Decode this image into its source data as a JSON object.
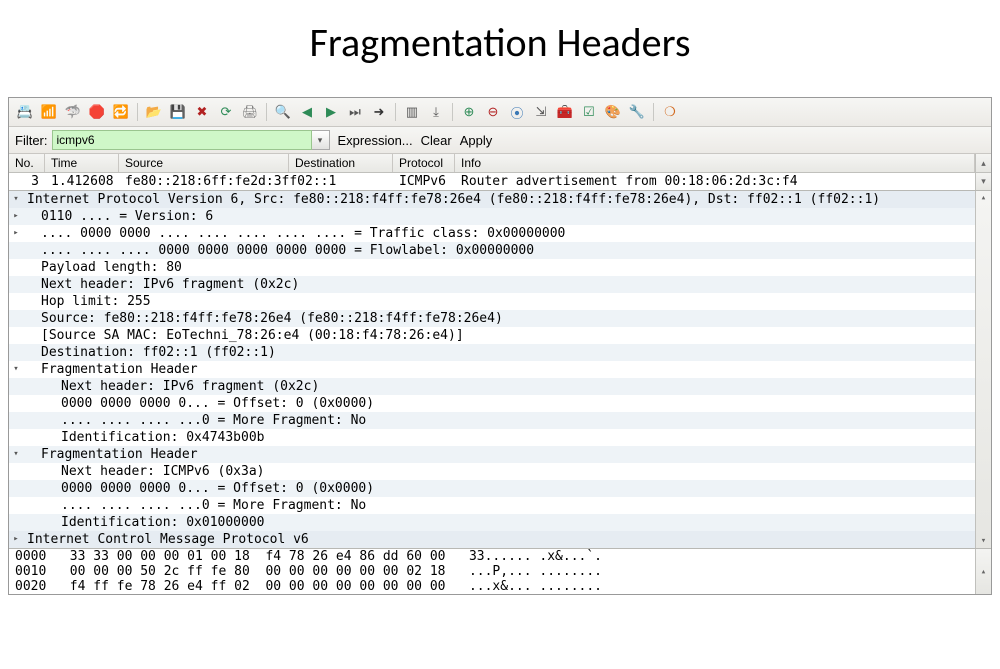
{
  "title": "Fragmentation Headers",
  "toolbar_icons": [
    {
      "name": "adapter-list-icon",
      "glyph": "📇",
      "color": "#777"
    },
    {
      "name": "adapter-options-icon",
      "glyph": "📶",
      "color": "#8a6d3b"
    },
    {
      "name": "start-capture-icon",
      "glyph": "🦈",
      "color": "#6b8e23"
    },
    {
      "name": "stop-capture-icon",
      "glyph": "🛑",
      "color": "#b22222"
    },
    {
      "name": "restart-capture-icon",
      "glyph": "🔁",
      "color": "#8a6d3b"
    },
    {
      "name": "sep"
    },
    {
      "name": "open-file-icon",
      "glyph": "📂",
      "color": "#3a78b5"
    },
    {
      "name": "save-file-icon",
      "glyph": "💾",
      "color": "#3a78b5"
    },
    {
      "name": "close-file-icon",
      "glyph": "✖",
      "color": "#b22222"
    },
    {
      "name": "reload-icon",
      "glyph": "⟳",
      "color": "#2e8b57"
    },
    {
      "name": "print-icon",
      "glyph": "🖨",
      "color": "#777"
    },
    {
      "name": "sep"
    },
    {
      "name": "find-icon",
      "glyph": "🔍",
      "color": "#3a78b5"
    },
    {
      "name": "go-back-icon",
      "glyph": "◀",
      "color": "#2e8b57"
    },
    {
      "name": "go-forward-icon",
      "glyph": "▶",
      "color": "#2e8b57"
    },
    {
      "name": "go-last-icon",
      "glyph": "⏭",
      "color": "#555"
    },
    {
      "name": "go-to-icon",
      "glyph": "➜",
      "color": "#333"
    },
    {
      "name": "sep"
    },
    {
      "name": "colorize-icon",
      "glyph": "▥",
      "color": "#555"
    },
    {
      "name": "auto-scroll-icon",
      "glyph": "⤓",
      "color": "#555"
    },
    {
      "name": "sep"
    },
    {
      "name": "zoom-in-icon",
      "glyph": "⊕",
      "color": "#2e8b57"
    },
    {
      "name": "zoom-out-icon",
      "glyph": "⊖",
      "color": "#b22222"
    },
    {
      "name": "zoom-reset-icon",
      "glyph": "⦿",
      "color": "#3a78b5"
    },
    {
      "name": "resize-cols-icon",
      "glyph": "⇲",
      "color": "#555"
    },
    {
      "name": "capture-filters-icon",
      "glyph": "🧰",
      "color": "#8a6d3b"
    },
    {
      "name": "display-filters-icon",
      "glyph": "☑",
      "color": "#2e8b57"
    },
    {
      "name": "coloring-rules-icon",
      "glyph": "🎨",
      "color": "#b8860b"
    },
    {
      "name": "prefs-icon",
      "glyph": "🔧",
      "color": "#555"
    },
    {
      "name": "sep"
    },
    {
      "name": "help-icon",
      "glyph": "❍",
      "color": "#d2691e"
    }
  ],
  "filter": {
    "label": "Filter:",
    "value": "icmpv6",
    "expression": "Expression...",
    "clear": "Clear",
    "apply": "Apply"
  },
  "columns": {
    "no": "No.",
    "time": "Time",
    "source": "Source",
    "destination": "Destination",
    "protocol": "Protocol",
    "info": "Info"
  },
  "row": {
    "no": "3",
    "time": "1.412608",
    "source": "fe80::218:6ff:fe2d:3ff02::1",
    "destination": "",
    "protocol": "ICMPv6",
    "info": "Router advertisement from 00:18:06:2d:3c:f4"
  },
  "details": [
    {
      "t": "Internet Protocol Version 6, Src: fe80::218:f4ff:fe78:26e4 (fe80::218:f4ff:fe78:26e4), Dst: ff02::1 (ff02::1)",
      "tw": "▾",
      "cls": "em"
    },
    {
      "t": "0110 .... = Version: 6",
      "tw": "▸",
      "cls": "alt indent1"
    },
    {
      "t": ".... 0000 0000 .... .... .... .... .... = Traffic class: 0x00000000",
      "tw": "▸",
      "cls": "indent1"
    },
    {
      "t": ".... .... .... 0000 0000 0000 0000 0000 = Flowlabel: 0x00000000",
      "cls": "alt indent1"
    },
    {
      "t": "Payload length: 80",
      "cls": "indent1"
    },
    {
      "t": "Next header: IPv6 fragment (0x2c)",
      "cls": "alt indent1"
    },
    {
      "t": "Hop limit: 255",
      "cls": "indent1"
    },
    {
      "t": "Source: fe80::218:f4ff:fe78:26e4 (fe80::218:f4ff:fe78:26e4)",
      "cls": "alt indent1"
    },
    {
      "t": "[Source SA MAC: EoTechni_78:26:e4 (00:18:f4:78:26:e4)]",
      "cls": "indent1"
    },
    {
      "t": "Destination: ff02::1 (ff02::1)",
      "cls": "alt indent1"
    },
    {
      "t": "Fragmentation Header",
      "tw": "▾",
      "cls": "indent1"
    },
    {
      "t": "Next header: IPv6 fragment (0x2c)",
      "cls": "alt indent2"
    },
    {
      "t": "0000 0000 0000 0... = Offset: 0 (0x0000)",
      "cls": "indent2"
    },
    {
      "t": ".... .... .... ...0 = More Fragment: No",
      "cls": "alt indent2"
    },
    {
      "t": "Identification: 0x4743b00b",
      "cls": "indent2"
    },
    {
      "t": "Fragmentation Header",
      "tw": "▾",
      "cls": "alt indent1"
    },
    {
      "t": "Next header: ICMPv6 (0x3a)",
      "cls": "indent2"
    },
    {
      "t": "0000 0000 0000 0... = Offset: 0 (0x0000)",
      "cls": "alt indent2"
    },
    {
      "t": ".... .... .... ...0 = More Fragment: No",
      "cls": "indent2"
    },
    {
      "t": "Identification: 0x01000000",
      "cls": "alt indent2"
    },
    {
      "t": "Internet Control Message Protocol v6",
      "tw": "▸",
      "cls": "em"
    }
  ],
  "hex": [
    "0000   33 33 00 00 00 01 00 18  f4 78 26 e4 86 dd 60 00   33...... .x&...`.",
    "0010   00 00 00 50 2c ff fe 80  00 00 00 00 00 00 02 18   ...P,... ........",
    "0020   f4 ff fe 78 26 e4 ff 02  00 00 00 00 00 00 00 00   ...x&... ........"
  ]
}
